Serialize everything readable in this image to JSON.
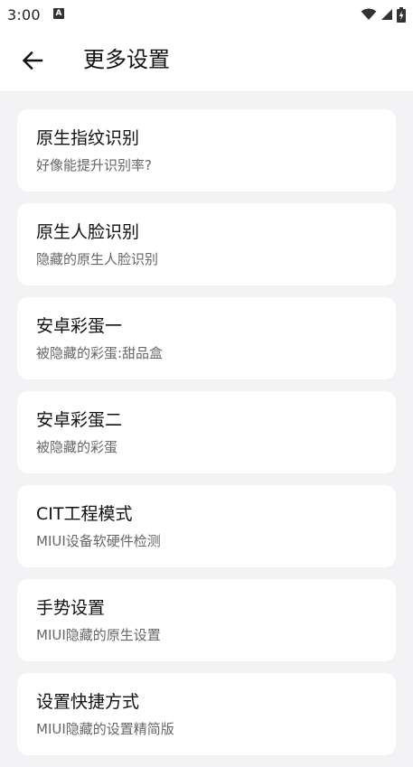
{
  "status_bar": {
    "time": "3:00",
    "notification_badge": "A",
    "icons": [
      "wifi-icon",
      "signal-icon",
      "battery-charging-icon"
    ]
  },
  "app_bar": {
    "back_icon": "arrow-left-icon",
    "title": "更多设置"
  },
  "settings": [
    {
      "title": "原生指纹识别",
      "subtitle": "好像能提升识别率?"
    },
    {
      "title": "原生人脸识别",
      "subtitle": "隐藏的原生人脸识别"
    },
    {
      "title": "安卓彩蛋一",
      "subtitle": "被隐藏的彩蛋:甜品盒"
    },
    {
      "title": "安卓彩蛋二",
      "subtitle": "被隐藏的彩蛋"
    },
    {
      "title": "CIT工程模式",
      "subtitle": "MIUI设备软硬件检测"
    },
    {
      "title": "手势设置",
      "subtitle": "MIUI隐藏的原生设置"
    },
    {
      "title": "设置快捷方式",
      "subtitle": "MIUI隐藏的设置精简版"
    }
  ],
  "colors": {
    "background": "#f3f3f5",
    "card": "#ffffff",
    "title_text": "#111111",
    "subtitle_text": "#666666"
  }
}
